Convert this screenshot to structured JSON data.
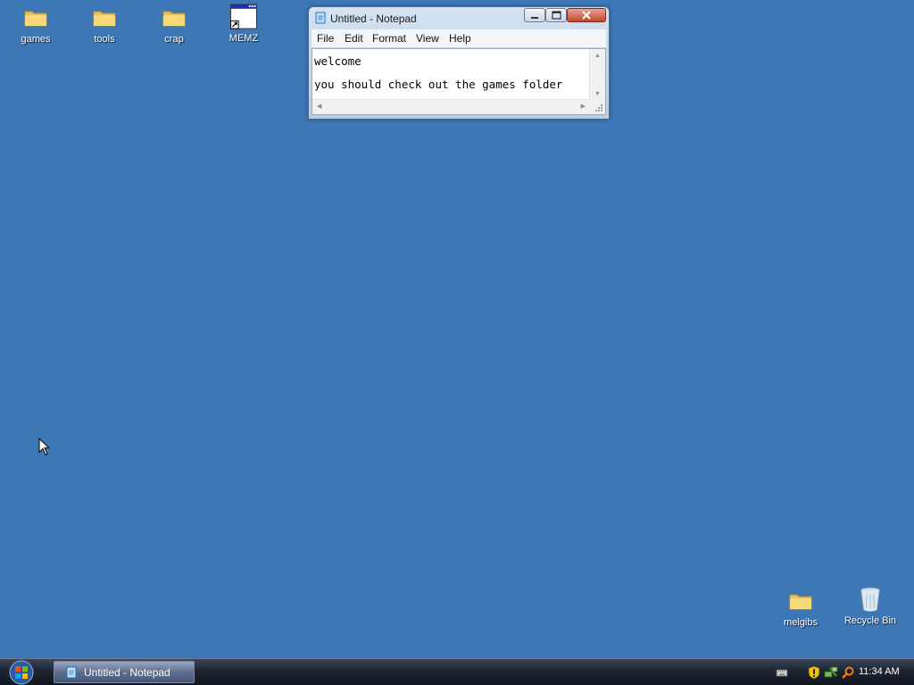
{
  "desktop": {
    "icons": [
      {
        "label": "games",
        "icon": "folder-icon"
      },
      {
        "label": "tools",
        "icon": "folder-icon"
      },
      {
        "label": "crap",
        "icon": "folder-icon"
      },
      {
        "label": "MEMZ",
        "icon": "application-shortcut-icon"
      },
      {
        "label": "melgibs",
        "icon": "folder-icon"
      },
      {
        "label": "Recycle Bin",
        "icon": "recycle-bin-icon"
      }
    ],
    "background_color": "#3d77b6"
  },
  "notepad": {
    "title": "Untitled - Notepad",
    "menu": [
      "File",
      "Edit",
      "Format",
      "View",
      "Help"
    ],
    "content_line1": "welcome",
    "content_line2": "you should check out the games folder"
  },
  "taskbar": {
    "start_icon": "windows-orb-icon",
    "task_label": "Untitled - Notepad",
    "clock": "11:34 AM",
    "tray_icons": [
      "keyboard-icon",
      "security-shield-icon",
      "network-icon",
      "search-icon"
    ]
  }
}
